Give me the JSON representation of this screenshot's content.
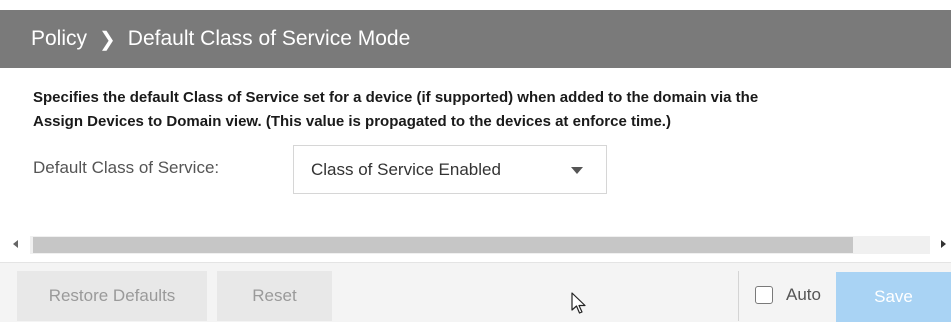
{
  "header": {
    "section": "Policy",
    "title": "Default Class of Service Mode"
  },
  "main": {
    "description_line1": "Specifies the default Class of Service set for a device (if supported) when added to the domain via the",
    "description_line2": "Assign Devices to Domain view. (This value is propagated to the devices at enforce time.)",
    "field_label": "Default Class of Service:",
    "select_value": "Class of Service Enabled"
  },
  "toolbar": {
    "restore_label": "Restore Defaults",
    "reset_label": "Reset",
    "auto_label": "Auto",
    "auto_checked": false,
    "save_label": "Save"
  },
  "colors": {
    "header_bg": "#7a7a7a",
    "save_bg": "#a9d3f4",
    "disabled_btn_bg": "#e8e8e8"
  },
  "icons": {
    "breadcrumb_separator": "chevron-right-icon",
    "select_caret": "caret-down-icon",
    "pointer": "mouse-pointer-icon"
  }
}
